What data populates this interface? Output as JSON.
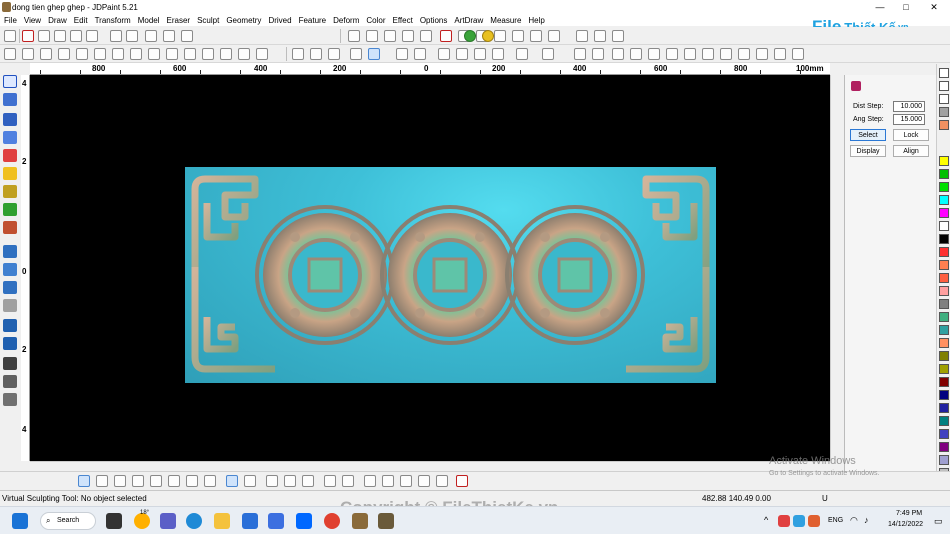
{
  "window": {
    "title": "dong tien ghep ghep - JDPaint 5.21",
    "min": "—",
    "max": "□",
    "close": "✕"
  },
  "menu": [
    "File",
    "View",
    "Draw",
    "Edit",
    "Transform",
    "Model",
    "Eraser",
    "Sculpt",
    "Geometry",
    "Drived",
    "Feature",
    "Deform",
    "Color",
    "Effect",
    "Options",
    "ArtDraw",
    "Measure",
    "Help"
  ],
  "logo": {
    "text_a": "File",
    "text_b": "Thiết Kế",
    "text_c": ".vn"
  },
  "ruler": {
    "labels": [
      "800",
      "600",
      "400",
      "200",
      "0",
      "200",
      "400",
      "600",
      "800"
    ],
    "unit": "100mm"
  },
  "vruler": {
    "labels": [
      "4",
      "2",
      "0",
      "2",
      "4"
    ]
  },
  "panel": {
    "dist_label": "Dist Step:",
    "dist_value": "10.000",
    "ang_label": "Ang Step:",
    "ang_value": "15.000",
    "select": "Select",
    "lock": "Lock",
    "display": "Display",
    "align": "Align"
  },
  "palette": [
    "#ffff00",
    "#00c000",
    "#00e000",
    "#00ffff",
    "#ff00ff",
    "#ffffff",
    "#000000",
    "#ff3030",
    "#ff7f50",
    "#ff6040",
    "#ffa0a0",
    "#808080",
    "#40b080",
    "#2fa0a0",
    "#ff9060",
    "#808000",
    "#a0a000",
    "#800000",
    "#000080",
    "#2020a0",
    "#008080",
    "#4040c0",
    "#800080",
    "#a0a0d0",
    "#c0c0c0"
  ],
  "status": {
    "left": "Virtual Sculpting Tool: No object selected",
    "coords": "482.88 140.49 0.00",
    "mode": "U"
  },
  "watermark": {
    "activate": "Activate Windows",
    "activate_sub": "Go to Settings to activate Windows.",
    "copyright": "Copyright © FileThietKe.vn"
  },
  "taskbar": {
    "search": "Search",
    "weather": "18°",
    "lang": "ENG",
    "time": "7:49 PM",
    "date": "14/12/2022"
  }
}
